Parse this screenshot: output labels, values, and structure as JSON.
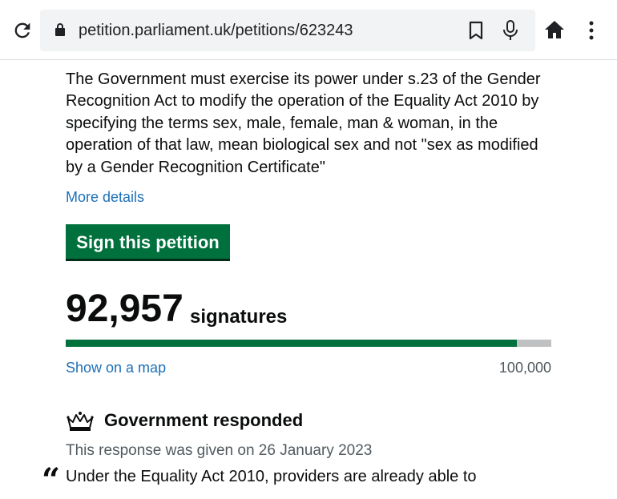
{
  "browser": {
    "url": "petition.parliament.uk/petitions/623243",
    "icons": [
      "reload-icon",
      "lock-icon",
      "bookmark-icon",
      "mic-icon",
      "home-icon",
      "menu-icon"
    ]
  },
  "petition": {
    "text": "The Government must exercise its power under s.23 of the Gender Recognition Act to modify the operation of the Equality Act 2010 by specifying the terms sex, male, female, man & woman, in the operation of that law, mean biological sex and not \"sex as modified by a Gender Recognition Certificate\"",
    "more_details": "More details",
    "sign_button": "Sign this petition"
  },
  "signatures": {
    "count": "92,957",
    "label": "signatures",
    "progress_fraction": 0.92957,
    "show_map": "Show on a map",
    "goal": "100,000"
  },
  "response": {
    "heading": "Government responded",
    "date_text": "This response was given on 26 January 2023",
    "quote_mark": "“",
    "text_start": "Under the Equality Act 2010, providers are already able to"
  },
  "colors": {
    "green": "#00703c",
    "link": "#1d70b8",
    "progress_track": "#bfc1c3",
    "secondary_text": "#505a5f"
  }
}
